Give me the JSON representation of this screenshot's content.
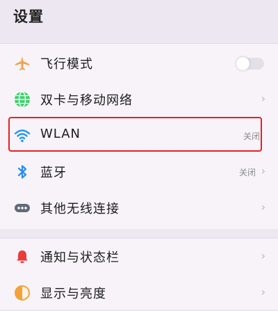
{
  "header": {
    "title": "设置"
  },
  "colors": {
    "accent": "#e62020",
    "airplane": "#f0a24a",
    "globe": "#3dcf6b",
    "wifi": "#2196f3",
    "bluetooth": "#2b8bf2",
    "more": "#5f6b78",
    "bell": "#ea3b3b",
    "display": "#f3a23a"
  },
  "settings": {
    "groups": [
      {
        "items": [
          {
            "label": "飞行模式",
            "icon": "airplane-icon",
            "control": "toggle",
            "enabled": false
          },
          {
            "label": "双卡与移动网络",
            "icon": "globe-icon",
            "control": "chevron"
          },
          {
            "label": "WLAN",
            "icon": "wifi-icon",
            "value": "关闭",
            "control": "none",
            "highlighted": true
          },
          {
            "label": "蓝牙",
            "icon": "bluetooth-icon",
            "value": "关闭",
            "control": "chevron"
          },
          {
            "label": "其他无线连接",
            "icon": "more-icon",
            "control": "chevron"
          }
        ]
      },
      {
        "items": [
          {
            "label": "通知与状态栏",
            "icon": "bell-icon",
            "control": "chevron"
          },
          {
            "label": "显示与亮度",
            "icon": "display-icon",
            "control": "chevron"
          }
        ]
      }
    ]
  },
  "chevron_glyph": "›"
}
